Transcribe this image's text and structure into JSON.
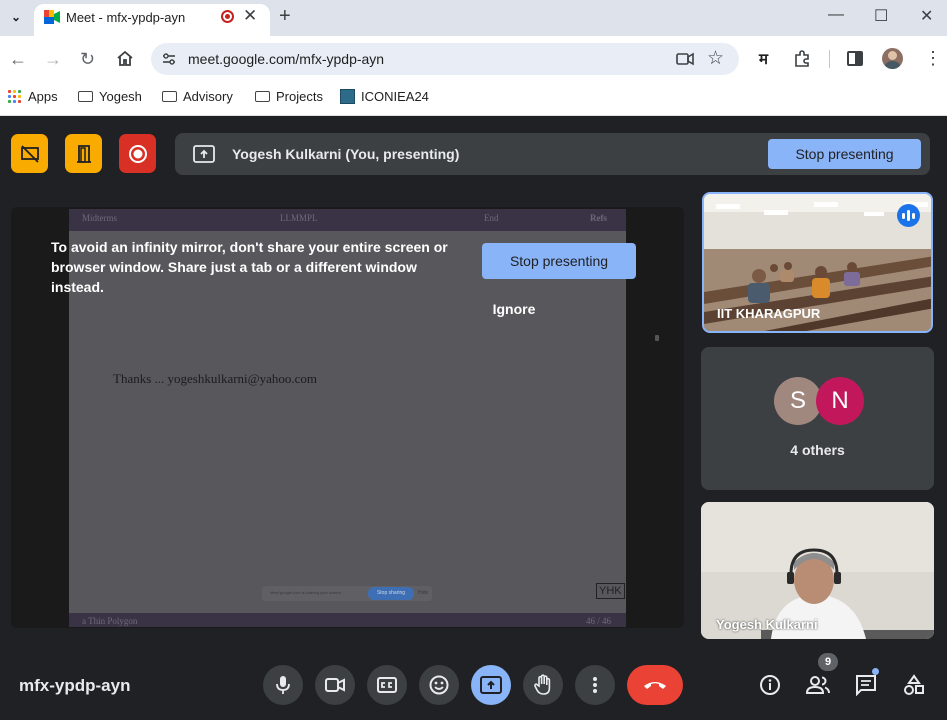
{
  "browser": {
    "tab_title": "Meet - mfx-ypdp-ayn",
    "url": "meet.google.com/mfx-ypdp-ayn",
    "profile_letter": "म",
    "bookmarks": [
      {
        "label": "Apps",
        "icon": "apps-grid-icon"
      },
      {
        "label": "Yogesh",
        "icon": "folder-icon"
      },
      {
        "label": "Advisory",
        "icon": "folder-icon"
      },
      {
        "label": "Projects",
        "icon": "folder-icon"
      },
      {
        "label": "ICONIEA24",
        "icon": "site-icon"
      }
    ]
  },
  "meet": {
    "presenting_text": "Yogesh Kulkarni (You, presenting)",
    "stop_presenting_label": "Stop presenting",
    "warning_text": "To avoid an infinity mirror, don't share your entire screen or browser window. Share just a tab or a different window instead.",
    "warning_stop_label": "Stop presenting",
    "ignore_label": "Ignore",
    "slide": {
      "header": [
        "Midterms",
        "LLMMPL",
        "End",
        "Refs"
      ],
      "body_text": "Thanks ...  yogeshkulkarni@yahoo.com",
      "footer_left": "a Thin Polygon",
      "footer_right": "46 / 46",
      "mini_share_text": "Meet.google.com is sharing your screen",
      "mini_stop_label": "Stop sharing",
      "mini_hide_label": "Hide",
      "logo": "YHK"
    },
    "tiles": [
      {
        "name": "IIT KHARAGPUR",
        "speaking": true
      },
      {
        "avatars": [
          "S",
          "N"
        ],
        "others_label": "4 others"
      },
      {
        "name": "Yogesh Kulkarni"
      }
    ],
    "meeting_code": "mfx-ypdp-ayn",
    "people_count": "9",
    "colors": {
      "accent": "#8ab4f8",
      "end_call": "#ea4335",
      "avatar_s": "#a1887f",
      "avatar_n": "#c2185b",
      "host_control": "#f9ab00",
      "record": "#d93025"
    }
  }
}
